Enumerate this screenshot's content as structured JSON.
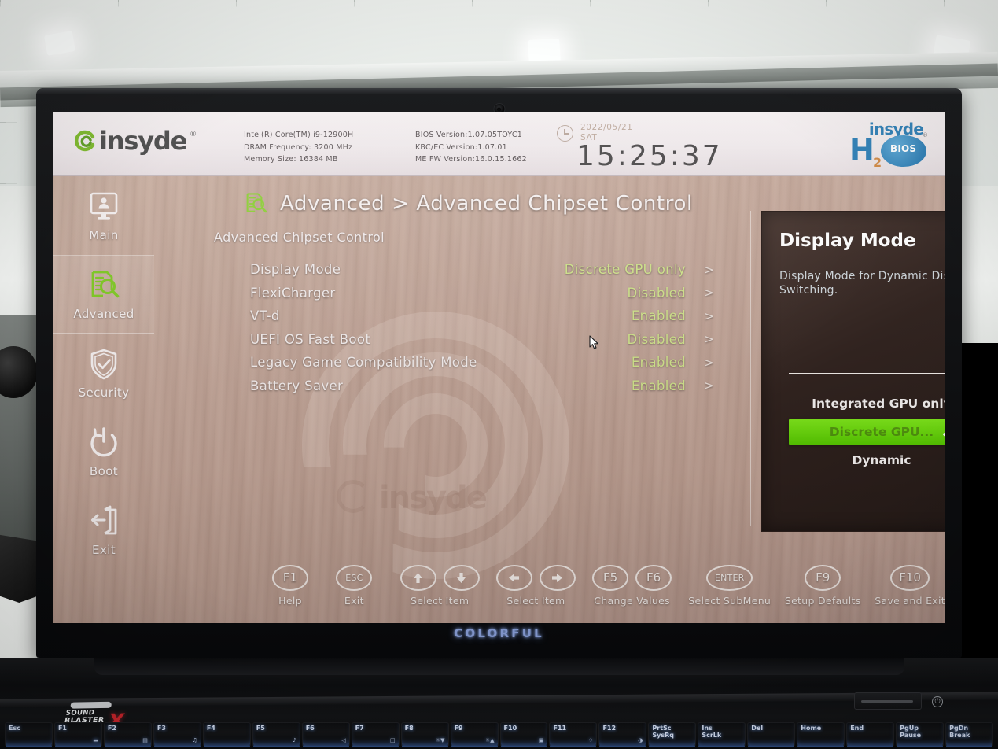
{
  "room": {
    "ceiling_lights": 3
  },
  "laptop": {
    "brand": "COLORFUL",
    "audio_badge": {
      "line1": "SOUND",
      "line2": "BLASTER",
      "line3": "BLASTERX",
      "mark": "X"
    },
    "keys": [
      {
        "label": "Esc",
        "sub": ""
      },
      {
        "label": "F1",
        "sub": "▬"
      },
      {
        "label": "F2",
        "sub": "▤"
      },
      {
        "label": "F3",
        "sub": "♫"
      },
      {
        "label": "F4",
        "sub": ""
      },
      {
        "label": "F5",
        "sub": "♪"
      },
      {
        "label": "F6",
        "sub": "◁"
      },
      {
        "label": "F7",
        "sub": "□"
      },
      {
        "label": "F8",
        "sub": "☀▼"
      },
      {
        "label": "F9",
        "sub": "☀▲"
      },
      {
        "label": "F10",
        "sub": "▣"
      },
      {
        "label": "F11",
        "sub": "✈"
      },
      {
        "label": "F12",
        "sub": "◑"
      },
      {
        "label": "PrtSc\nSysRq",
        "sub": ""
      },
      {
        "label": "Ins\nScrLk",
        "sub": ""
      },
      {
        "label": "Del",
        "sub": ""
      },
      {
        "label": "Home",
        "sub": ""
      },
      {
        "label": "End",
        "sub": ""
      },
      {
        "label": "PgUp\nPause",
        "sub": ""
      },
      {
        "label": "PgDn\nBreak",
        "sub": ""
      }
    ]
  },
  "bios": {
    "header": {
      "logo_text": "insyde",
      "logo_reg": "®",
      "system_info_left": [
        "Intel(R) Core(TM) i9-12900H",
        "DRAM Frequency: 3200 MHz",
        "Memory Size: 16384 MB"
      ],
      "system_info_right": [
        "BIOS Version:1.07.05TOYC1",
        "KBC/EC Version:1.07.01",
        "ME FW Version:16.0.15.1662"
      ],
      "date": "2022/05/21",
      "weekday": "SAT",
      "time": "15:25:37",
      "brand": {
        "word": "insyde",
        "h": "H",
        "sub": "2",
        "badge": "BIOS",
        "reg": "®"
      }
    },
    "sidebar": {
      "items": [
        {
          "label": "Main",
          "icon": "monitor-user-icon",
          "active": false
        },
        {
          "label": "Advanced",
          "icon": "document-search-icon",
          "active": true
        },
        {
          "label": "Security",
          "icon": "shield-check-icon",
          "active": false
        },
        {
          "label": "Boot",
          "icon": "power-icon",
          "active": false
        },
        {
          "label": "Exit",
          "icon": "exit-door-icon",
          "active": false
        }
      ]
    },
    "breadcrumb": "Advanced > Advanced Chipset Control",
    "breadcrumb_icon": "document-search-icon",
    "section_title": "Advanced Chipset Control",
    "settings": [
      {
        "label": "Display Mode",
        "value": "Discrete GPU only",
        "arrow": ">"
      },
      {
        "label": "FlexiCharger",
        "value": "Disabled",
        "arrow": ">"
      },
      {
        "label": "VT-d",
        "value": "Enabled",
        "arrow": ">"
      },
      {
        "label": "UEFI OS Fast Boot",
        "value": "Disabled",
        "arrow": ">"
      },
      {
        "label": "Legacy Game Compatibility Mode",
        "value": "Enabled",
        "arrow": ">"
      },
      {
        "label": "Battery Saver",
        "value": "Enabled",
        "arrow": ">"
      }
    ],
    "watermark": "insyde",
    "help": {
      "title": "Display Mode",
      "icon": "document-search-icon",
      "description": "Display Mode for Dynamic Display Switching.",
      "options": [
        {
          "label": "Integrated GPU only",
          "selected": false
        },
        {
          "label": "Discrete GPU...",
          "selected": true
        },
        {
          "label": "Dynamic",
          "selected": false
        }
      ]
    },
    "footer": [
      {
        "keys": [
          "F1"
        ],
        "label": "Help",
        "type": "text"
      },
      {
        "keys": [
          "ESC"
        ],
        "label": "Exit",
        "type": "text"
      },
      {
        "keys": [
          "↑",
          "↓"
        ],
        "label": "Select Item",
        "type": "arrow-vertical"
      },
      {
        "keys": [
          "←",
          "→"
        ],
        "label": "Select Item",
        "type": "arrow-horizontal"
      },
      {
        "keys": [
          "F5",
          "F6"
        ],
        "label": "Change Values",
        "type": "text"
      },
      {
        "keys": [
          "ENTER"
        ],
        "label": "Select  SubMenu",
        "type": "text"
      },
      {
        "keys": [
          "F9"
        ],
        "label": "Setup Defaults",
        "type": "text"
      },
      {
        "keys": [
          "F10"
        ],
        "label": "Save and Exit",
        "type": "text"
      }
    ],
    "colors": {
      "accent_green": "#6fc21a",
      "value_green": "#cfe38a",
      "panel_dark": "#30221e",
      "header_bg": "#efe9eb",
      "wood_bg": "#c2a598"
    }
  }
}
